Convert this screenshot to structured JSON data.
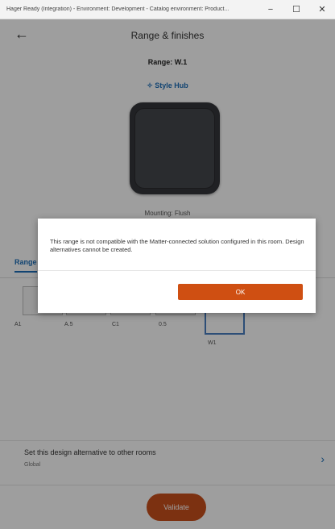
{
  "window": {
    "title": "Hager Ready (Integration) - Environment: Development - Catalog environment: Product...",
    "minimize_glyph": "−",
    "maximize_glyph": "☐",
    "close_glyph": "✕"
  },
  "header": {
    "back_icon": "arrow-left-icon",
    "back_glyph": "←",
    "title": "Range & finishes"
  },
  "range": {
    "name": "Range: W.1",
    "style_hub_icon": "magic-wand-icon",
    "style_hub": "Style Hub",
    "mounting": "Mounting: Flush"
  },
  "tabs": [
    {
      "label": "Range"
    }
  ],
  "swatches": [
    {
      "label": "A1"
    },
    {
      "label": "A.5"
    },
    {
      "label": "C1"
    },
    {
      "label": "0.5"
    },
    {
      "label": "W1"
    }
  ],
  "set_alternative": {
    "title": "Set this design alternative to other rooms",
    "subtitle": "Global",
    "chevron": "›"
  },
  "validate_label": "Validate",
  "dialog": {
    "message": "This range is not compatible with the Matter-connected solution configured in this room. Design alternatives cannot be created.",
    "ok_label": "OK"
  },
  "colors": {
    "accent_blue": "#1d6fb8",
    "validate": "#c94f1c",
    "ok_button": "#cf4f12"
  }
}
